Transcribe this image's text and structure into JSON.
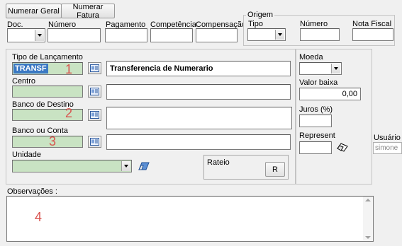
{
  "toolbar": {
    "numerar_geral": "Numerar Geral",
    "numerar_fatura": "Numerar Fatura"
  },
  "header": {
    "doc_label": "Doc.",
    "numero_label": "Número",
    "pagamento_label": "Pagamento",
    "competencia_label": "Competência",
    "compensacao_label": "Compensação"
  },
  "origem": {
    "title": "Origem",
    "tipo_label": "Tipo",
    "numero_label": "Número",
    "nota_fiscal_label": "Nota Fiscal"
  },
  "form": {
    "tipo_lancamento_label": "Tipo de Lançamento",
    "tipo_lancamento_value": "TRANSF",
    "tipo_lancamento_desc": "Transferencia de Numerario",
    "centro_label": "Centro",
    "banco_destino_label": "Banco de Destino",
    "banco_conta_label": "Banco ou Conta",
    "unidade_label": "Unidade",
    "rateio_label": "Rateio",
    "rateio_button": "R"
  },
  "side": {
    "moeda_label": "Moeda",
    "valor_baixa_label": "Valor baixa",
    "valor_baixa_value": "0,00",
    "juros_label": "Juros (%)",
    "represent_label": "Represent",
    "usuario_label": "Usuário",
    "usuario_value": "simone"
  },
  "observacoes": {
    "label": "Observações :"
  },
  "markers": {
    "m1": "1",
    "m2": "2",
    "m3": "3",
    "m4": "4"
  },
  "icons": {
    "lookup": "lookup-icon",
    "eraser": "eraser-icon",
    "represent": "eraser-icon"
  }
}
